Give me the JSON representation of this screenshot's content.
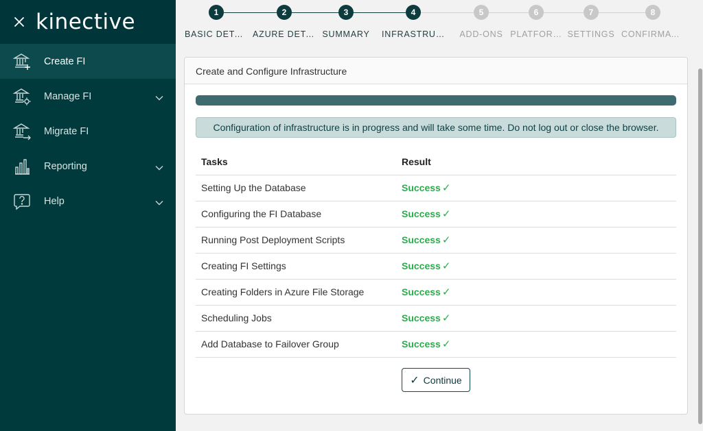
{
  "sidebar": {
    "logo": "kinective",
    "items": [
      {
        "label": "Create FI",
        "icon": "bank-plus-icon",
        "active": true,
        "expandable": false
      },
      {
        "label": "Manage FI",
        "icon": "bank-gear-icon",
        "active": false,
        "expandable": true
      },
      {
        "label": "Migrate FI",
        "icon": "bank-arrow-icon",
        "active": false,
        "expandable": false
      },
      {
        "label": "Reporting",
        "icon": "bar-chart-icon",
        "active": false,
        "expandable": true
      },
      {
        "label": "Help",
        "icon": "help-bubble-icon",
        "active": false,
        "expandable": true
      }
    ]
  },
  "stepper": {
    "steps": [
      {
        "number": "1",
        "label": "BASIC DETA…",
        "state": "complete"
      },
      {
        "number": "2",
        "label": "AZURE DETA…",
        "state": "complete"
      },
      {
        "number": "3",
        "label": "SUMMARY",
        "state": "complete"
      },
      {
        "number": "4",
        "label": "INFRASTRUCT…",
        "state": "current"
      },
      {
        "number": "5",
        "label": "ADD-ONS",
        "state": "pending"
      },
      {
        "number": "6",
        "label": "PLATFOR…",
        "state": "pending"
      },
      {
        "number": "7",
        "label": "SETTINGS",
        "state": "pending"
      },
      {
        "number": "8",
        "label": "CONFIRMATI…",
        "state": "pending"
      }
    ]
  },
  "card": {
    "title": "Create and Configure Infrastructure",
    "progress_percent": 100,
    "alert": "Configuration of infrastructure is in progress and will take some time. Do not log out or close the browser.",
    "table": {
      "headers": [
        "Tasks",
        "Result"
      ],
      "rows": [
        {
          "task": "Setting Up the Database",
          "result": "Success"
        },
        {
          "task": "Configuring the FI Database",
          "result": "Success"
        },
        {
          "task": "Running Post Deployment Scripts",
          "result": "Success"
        },
        {
          "task": "Creating FI Settings",
          "result": "Success"
        },
        {
          "task": "Creating Folders in Azure File Storage",
          "result": "Success"
        },
        {
          "task": "Scheduling Jobs",
          "result": "Success"
        },
        {
          "task": "Add Database to Failover Group",
          "result": "Success"
        }
      ]
    },
    "continue_label": "Continue"
  },
  "colors": {
    "sidebar_bg": "#003a3d",
    "step_complete": "#0d3b3e",
    "step_pending": "#c8c8c8",
    "success": "#2eab4e"
  }
}
